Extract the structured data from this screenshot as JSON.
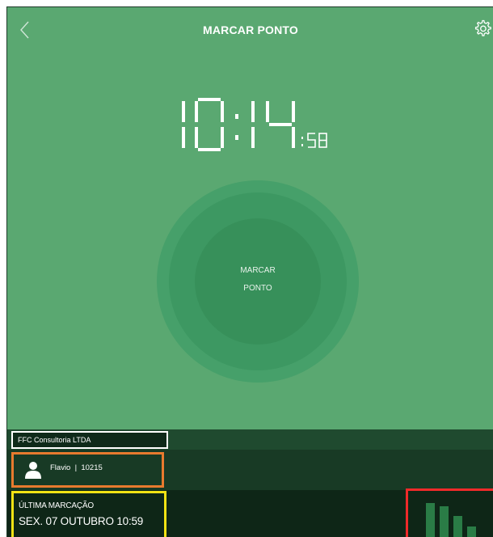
{
  "header": {
    "title": "MARCAR PONTO",
    "back_icon": "chevron-left-icon",
    "settings_icon": "gear-icon"
  },
  "clock": {
    "hours": "10",
    "minutes": "14",
    "seconds": "58"
  },
  "punch_button": {
    "line1": "MARCAR",
    "line2": "PONTO"
  },
  "company": {
    "name": "FFC Consultoria LTDA"
  },
  "user": {
    "name": "Flavio",
    "id": "10215",
    "label": "Flavio  |  10215",
    "icon": "user-icon"
  },
  "last_punch": {
    "label": "ÚLTIMA MARCAÇÃO",
    "value": "SEX. 07 OUTUBRO 10:59"
  },
  "signal": {
    "icon": "signal-bars-icon",
    "levels": [
      1.0,
      0.9,
      0.6,
      0.3
    ]
  },
  "colors": {
    "background": "#5aa871",
    "circle": "#3d9862",
    "company_highlight": "#ffffff",
    "user_highlight": "#e87a2e",
    "last_punch_highlight": "#f1e214",
    "signal_highlight": "#ef2a2a"
  }
}
